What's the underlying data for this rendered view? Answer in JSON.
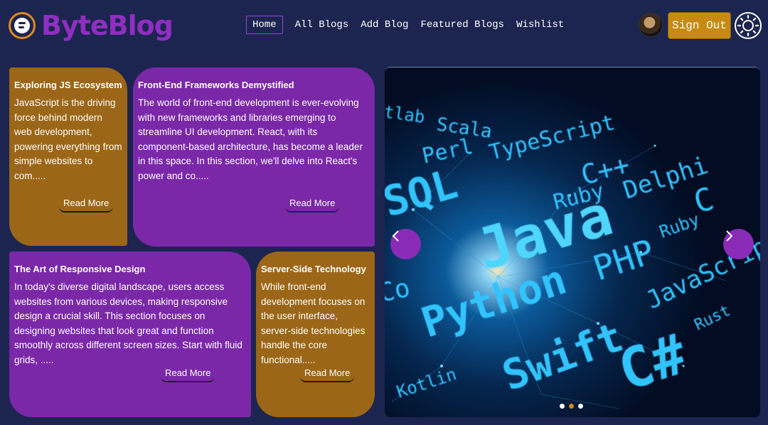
{
  "brand": {
    "name": "ByteBlog",
    "icon": "blogger-icon"
  },
  "nav": {
    "links": [
      "Home",
      "All Blogs",
      "Add Blog",
      "Featured Blogs",
      "Wishlist"
    ],
    "active": "Home"
  },
  "header": {
    "signout_label": "Sign Out",
    "avatar_icon": "user-avatar",
    "theme_icon": "sun-icon"
  },
  "cards": [
    {
      "title": "Exploring JS Ecosystem",
      "text": "JavaScript is the driving force behind modern web development, powering everything from simple websites to com.....",
      "button": "Read More"
    },
    {
      "title": "Front-End Frameworks Demystified",
      "text": "The world of front-end development is ever-evolving with new frameworks and libraries emerging to streamline UI development. React, with its component-based architecture, has become a leader in this space. In this section, we'll delve into React's power and co.....",
      "button": "Read More"
    },
    {
      "title": "The Art of Responsive Design",
      "text": "In today's diverse digital landscape, users access websites from various devices, making responsive design a crucial skill. This section focuses on designing websites that look great and function smoothly across different screen sizes. Start with fluid grids, .....",
      "button": "Read More"
    },
    {
      "title": "Server-Side Technology",
      "text": "While front-end development focuses on the user interface, server-side technologies handle the core functional.....",
      "button": "Read More"
    }
  ],
  "carousel": {
    "languages": [
      "tlab",
      "Scala",
      "Perl",
      "TypeScript",
      "C++",
      "SQL",
      "Ruby",
      "Delphi",
      "C",
      "Java",
      "Ruby",
      "PHP",
      "Python",
      "JavaScript",
      "Co",
      "Swift",
      "C#",
      "Rust",
      "Kotlin"
    ],
    "prev_icon": "chevron-left-icon",
    "next_icon": "chevron-right-icon",
    "slide_count": 3,
    "active_slide": 2
  },
  "colors": {
    "background": "#1c2450",
    "gold": "#9b6617",
    "purple": "#7a28a8",
    "accent": "#c78a12"
  }
}
